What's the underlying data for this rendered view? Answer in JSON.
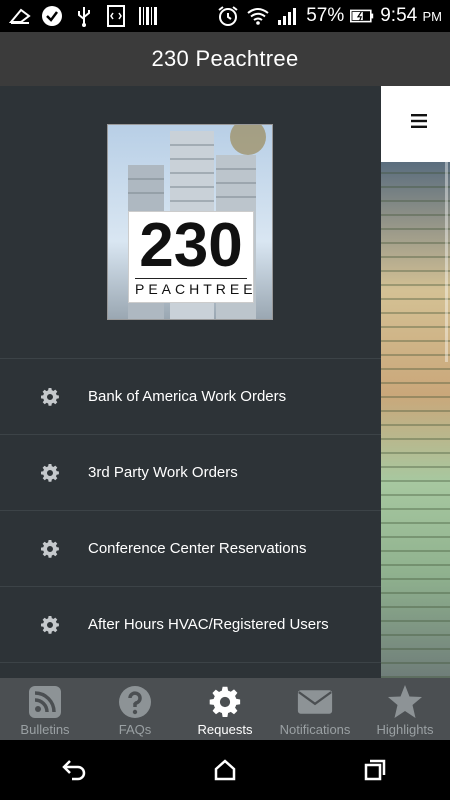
{
  "status_bar": {
    "battery_percent": "57%",
    "time": "9:54",
    "ampm": "PM"
  },
  "app_bar": {
    "title": "230 Peachtree"
  },
  "logo": {
    "number": "230",
    "word": "PEACHTREE"
  },
  "menu": {
    "items": [
      {
        "label": "Bank of America Work Orders",
        "icon": "gear-icon"
      },
      {
        "label": "3rd Party Work Orders",
        "icon": "gear-icon"
      },
      {
        "label": "Conference Center Reservations",
        "icon": "gear-icon"
      },
      {
        "label": "After Hours HVAC/Registered Users",
        "icon": "gear-icon"
      }
    ]
  },
  "tabs": [
    {
      "label": "Bulletins",
      "icon": "rss-icon",
      "active": false
    },
    {
      "label": "FAQs",
      "icon": "question-icon",
      "active": false
    },
    {
      "label": "Requests",
      "icon": "gear-icon",
      "active": true
    },
    {
      "label": "Notifications",
      "icon": "envelope-icon",
      "active": false
    },
    {
      "label": "Highlights",
      "icon": "star-icon",
      "active": false
    }
  ],
  "colors": {
    "drawer_bg": "#2d3337",
    "app_bar_bg": "#3b3b3b",
    "tab_bar_bg": "#4b4f52",
    "tab_active": "#ffffff",
    "tab_inactive": "#9aa0a3"
  }
}
